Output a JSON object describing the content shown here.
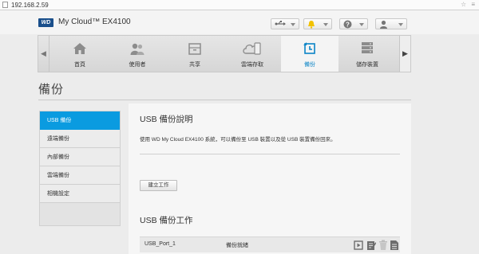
{
  "browser": {
    "url": "192.168.2.59",
    "right_icons": "☆ ≡"
  },
  "header": {
    "logo_text": "WD",
    "product_name": "My Cloud™ EX4100",
    "buttons": [
      {
        "icon": "usb-icon",
        "glyph": "⟜"
      },
      {
        "icon": "alert-bell-icon",
        "glyph": "🔔"
      },
      {
        "icon": "help-icon",
        "glyph": "?"
      },
      {
        "icon": "user-icon",
        "glyph": "👤"
      }
    ]
  },
  "nav": {
    "items": [
      {
        "label": "首頁",
        "icon": "home-icon"
      },
      {
        "label": "使用者",
        "icon": "users-icon"
      },
      {
        "label": "共享",
        "icon": "share-folder-icon"
      },
      {
        "label": "雲端存取",
        "icon": "cloud-access-icon"
      },
      {
        "label": "備份",
        "icon": "backup-icon",
        "active": true
      },
      {
        "label": "儲存裝置",
        "icon": "storage-icon"
      }
    ],
    "left_arrow": "◀",
    "right_arrow": "▶"
  },
  "page": {
    "title": "備份"
  },
  "sidebar": {
    "items": [
      {
        "label": "USB 備份",
        "active": true
      },
      {
        "label": "遠端備份"
      },
      {
        "label": "內部備份"
      },
      {
        "label": "雲端備份"
      },
      {
        "label": "相機設定"
      }
    ]
  },
  "main": {
    "section1_title": "USB 備份說明",
    "description": "使用 WD My Cloud EX4100 系統，可以備份至 USB 裝置以及從 USB 裝置備份回來。",
    "create_button": "建立工作",
    "section2_title": "USB 備份工作",
    "jobs": [
      {
        "name": "USB_Port_1",
        "status": "備份就緒"
      }
    ],
    "job_actions": [
      "run-icon",
      "edit-icon",
      "delete-icon",
      "details-icon"
    ]
  },
  "colors": {
    "accent": "#0a9be0",
    "logo_blue": "#1a4f8b"
  }
}
